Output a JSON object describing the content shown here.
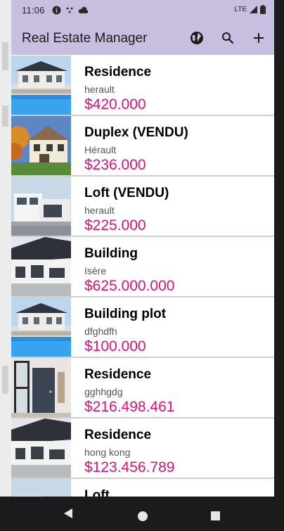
{
  "status": {
    "time": "11:06",
    "network": "LTE"
  },
  "app": {
    "title": "Real Estate Manager"
  },
  "listings": [
    {
      "type": "Residence",
      "city": "herault",
      "price": "$420.000",
      "photo": "pool-villa"
    },
    {
      "type": "Duplex (VENDU)",
      "city": "Hérault",
      "price": "$236.000",
      "photo": "chalet"
    },
    {
      "type": "Loft (VENDU)",
      "city": "herault",
      "price": "$225.000",
      "photo": "modern-white"
    },
    {
      "type": "Building",
      "city": "Isère",
      "price": "$625.000.000",
      "photo": "modern-gray"
    },
    {
      "type": "Building plot",
      "city": "dfghdfh",
      "price": "$100.000",
      "photo": "pool-villa"
    },
    {
      "type": "Residence",
      "city": "gghhgdg",
      "price": "$216.498.461",
      "photo": "interior-door"
    },
    {
      "type": "Residence",
      "city": "hong kong",
      "price": "$123.456.789",
      "photo": "modern-gray"
    },
    {
      "type": "Loft",
      "city": "",
      "price": "",
      "photo": "modern-white"
    }
  ],
  "colors": {
    "appbar": "#c8bfe0",
    "price": "#d8127a"
  },
  "icons": {
    "globe": "globe-icon",
    "search": "search-icon",
    "add": "add-icon"
  }
}
